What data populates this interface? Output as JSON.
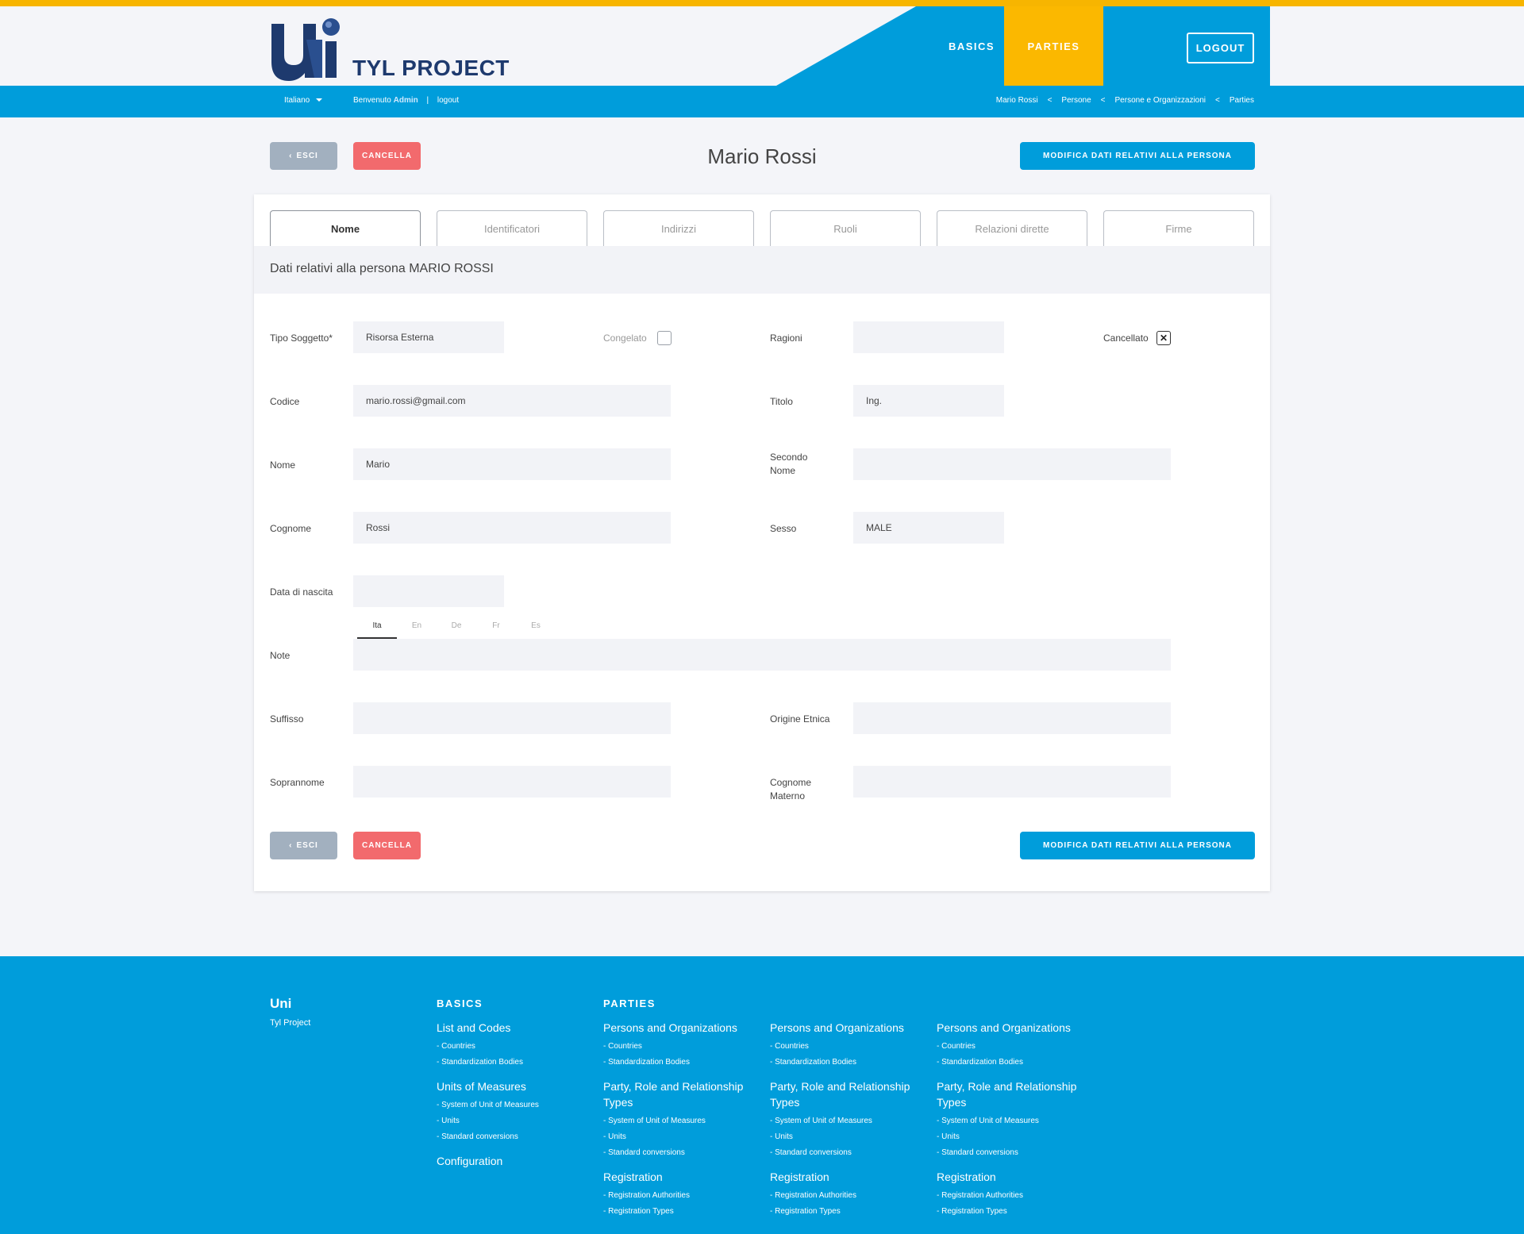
{
  "app": {
    "title": "TYL PROJECT"
  },
  "nav": {
    "basics": "BASICS",
    "parties": "PARTIES",
    "logout": "LOGOUT"
  },
  "subbar": {
    "language": "Italiano",
    "welcome": "Benvenuto",
    "user": "Admin",
    "separator": "|",
    "logout_link": "logout",
    "breadcrumbs": [
      "Mario Rossi",
      "<",
      "Persone",
      "<",
      "Persone e Organizzazioni",
      "<",
      "Parties"
    ]
  },
  "actions": {
    "esci": "ESCI",
    "cancella": "CANCELLA",
    "modifica": "MODIFICA DATI RELATIVI ALLA PERSONA"
  },
  "page": {
    "title": "Mario Rossi"
  },
  "tabs": [
    "Nome",
    "Identificatori",
    "Indirizzi",
    "Ruoli",
    "Relazioni dirette",
    "Firme"
  ],
  "section": {
    "title": "Dati relativi alla persona MARIO ROSSI"
  },
  "form": {
    "tipo_soggetto": {
      "label": "Tipo Soggetto*",
      "value": "Risorsa Esterna"
    },
    "congelato": {
      "label": "Congelato",
      "checked": false
    },
    "ragioni": {
      "label": "Ragioni",
      "value": ""
    },
    "cancellato": {
      "label": "Cancellato",
      "checked": true,
      "mark": "✕"
    },
    "codice": {
      "label": "Codice",
      "value": "mario.rossi@gmail.com"
    },
    "titolo": {
      "label": "Titolo",
      "value": "Ing."
    },
    "nome": {
      "label": "Nome",
      "value": "Mario"
    },
    "secondo_nome": {
      "label_1": "Secondo",
      "label_2": "Nome",
      "value": ""
    },
    "cognome": {
      "label": "Cognome",
      "value": "Rossi"
    },
    "sesso": {
      "label": "Sesso",
      "value": "MALE"
    },
    "data_nascita": {
      "label": "Data di nascita",
      "value": ""
    },
    "note": {
      "label": "Note",
      "value": "",
      "languages": [
        "Ita",
        "En",
        "De",
        "Fr",
        "Es"
      ]
    },
    "suffisso": {
      "label": "Suffisso",
      "value": ""
    },
    "origine_etnica": {
      "label": "Origine Etnica",
      "value": ""
    },
    "soprannome": {
      "label": "Soprannome",
      "value": ""
    },
    "cognome_materno": {
      "label_1": "Cognome",
      "label_2": "Materno",
      "value": ""
    }
  },
  "footer": {
    "brand": "Uni",
    "brand_sub": "Tyl Project",
    "basics_heading": "BASICS",
    "parties_heading": "PARTIES",
    "basics": {
      "group1": "List and Codes",
      "group1_links": [
        "- Countries",
        "- Standardization Bodies"
      ],
      "group2": "Units of Measures",
      "group2_links": [
        "- System of Unit of Measures",
        "- Units",
        "- Standard conversions"
      ],
      "group3": "Configuration"
    },
    "parties": {
      "group1": "Persons and Organizations",
      "group1_links": [
        "- Countries",
        "- Standardization Bodies"
      ],
      "group2_line1": "Party, Role and Relationship",
      "group2_line2": "Types",
      "group2_links": [
        "- System of Unit of Measures",
        "- Units",
        "- Standard conversions"
      ],
      "group3": "Registration",
      "group3_links": [
        "- Registration Authorities",
        "- Registration Types"
      ]
    }
  },
  "colors": {
    "accent": "#009ddb",
    "yellow": "#fbb800",
    "danger": "#f26a6d",
    "muted": "#a2b0bf",
    "brand_dark": "#1e3a6e"
  },
  "icons": {
    "logo": "uni-logo",
    "chevron": "chevron-left-icon",
    "caret": "caret-down-icon",
    "close": "close-icon"
  }
}
